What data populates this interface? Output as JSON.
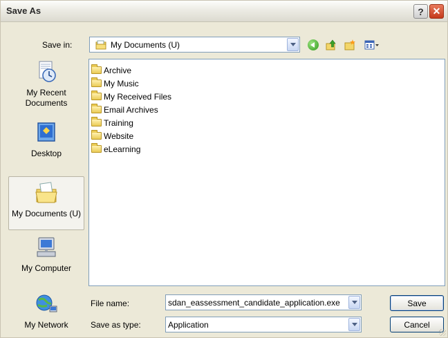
{
  "window": {
    "title": "Save As",
    "help_glyph": "?",
    "close_glyph": "✕"
  },
  "save_in": {
    "label": "Save in:",
    "value": "My Documents (U)"
  },
  "toolbar": {
    "icons": [
      "back-icon",
      "up-folder-icon",
      "new-folder-icon",
      "views-menu-icon"
    ]
  },
  "places": [
    {
      "label": "My Recent Documents",
      "icon": "recent-documents-icon",
      "active": false
    },
    {
      "label": "Desktop",
      "icon": "desktop-icon",
      "active": false
    },
    {
      "label": "My Documents (U)",
      "icon": "my-documents-icon",
      "active": true
    },
    {
      "label": "My Computer",
      "icon": "computer-icon",
      "active": false
    },
    {
      "label": "My Network",
      "icon": "network-icon",
      "active": false
    }
  ],
  "files": [
    "Archive",
    "My Music",
    "My Received Files",
    "Email Archives",
    "Training",
    "Website",
    "eLearning"
  ],
  "file_name": {
    "label": "File name:",
    "value": "sdan_eassessment_candidate_application.exe"
  },
  "save_as_type": {
    "label": "Save as type:",
    "value": "Application"
  },
  "buttons": {
    "save": "Save",
    "cancel": "Cancel"
  },
  "colors": {
    "accent_border": "#7f9db9",
    "dialog_bg": "#ece9d8",
    "close_red": "#c4391a"
  }
}
